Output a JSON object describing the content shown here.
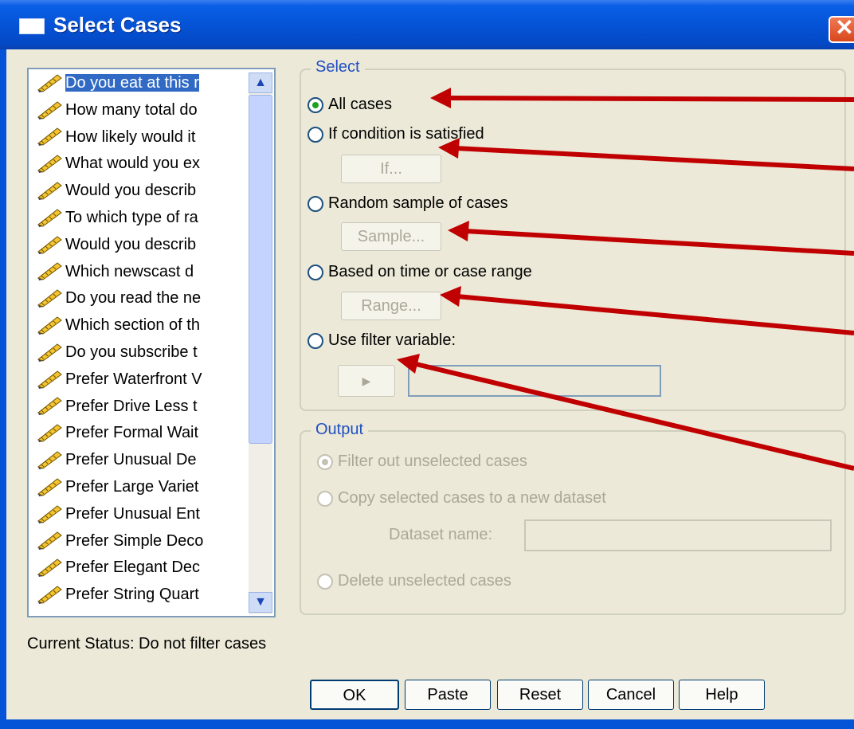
{
  "window": {
    "title": "Select Cases",
    "close_glyph": "✕"
  },
  "variables": [
    "Do you eat at this r",
    "How many total do",
    "How likely would it",
    "What would you ex",
    "Would you describ",
    "To which type of ra",
    "Would you describ",
    "Which newscast d",
    "Do you read the ne",
    "Which section of th",
    "Do you subscribe t",
    "Prefer Waterfront V",
    "Prefer Drive Less t",
    "Prefer Formal Wait",
    "Prefer Unusual De",
    "Prefer Large Variet",
    "Prefer Unusual Ent",
    "Prefer Simple Deco",
    "Prefer Elegant Dec",
    "Prefer String Quart"
  ],
  "variable_icon": "ruler-pencil-icon",
  "scroll": {
    "up": "▲",
    "down": "▼"
  },
  "select": {
    "legend": "Select",
    "all_cases": "All cases",
    "if_condition": "If condition is satisfied",
    "if_button": "If...",
    "random_sample": "Random sample of cases",
    "sample_button": "Sample...",
    "time_range": "Based on time or case range",
    "range_button": "Range...",
    "filter_variable": "Use filter variable:",
    "move_button": "▶",
    "selected_option": "all_cases"
  },
  "output": {
    "legend": "Output",
    "filter_out": "Filter out unselected cases",
    "copy_selected": "Copy selected cases to a new dataset",
    "dataset_name_label": "Dataset name:",
    "delete_unselected": "Delete unselected cases"
  },
  "status": "Current Status: Do not filter cases",
  "buttons": {
    "ok": "OK",
    "paste": "Paste",
    "reset": "Reset",
    "cancel": "Cancel",
    "help": "Help"
  },
  "colors": {
    "titlebar": "#0553d6",
    "selection": "#316ac5",
    "arrow": "#c00000",
    "legend_text": "#1f4fc1"
  }
}
